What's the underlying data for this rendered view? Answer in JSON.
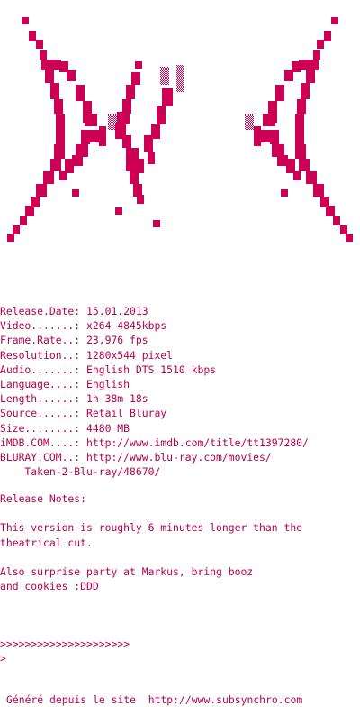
{
  "colors": {
    "text": "#b8004f",
    "art": "#cc0055",
    "background": "#ffffff"
  },
  "logo": {
    "icon": "butterfly-ascii-art-icon"
  },
  "info": [
    {
      "key": "Release.Date:",
      "value": "15.01.2013"
    },
    {
      "key": "Video.......:",
      "value": "x264 4845kbps"
    },
    {
      "key": "Frame.Rate..:",
      "value": "23,976 fps"
    },
    {
      "key": "Resolution..:",
      "value": "1280x544 pixel"
    },
    {
      "key": "Audio.......:",
      "value": "English DTS 1510 kbps"
    },
    {
      "key": "Language....:",
      "value": "English"
    },
    {
      "key": "Length......:",
      "value": "1h 38m 18s"
    },
    {
      "key": "Source......:",
      "value": "Retail Bluray"
    },
    {
      "key": "Size........:",
      "value": "4480 MB"
    },
    {
      "key": "iMDB.COM....:",
      "value": "http://www.imdb.com/title/tt1397280/"
    },
    {
      "key": "BLURAY.COM..:",
      "value": "http://www.blu-ray.com/movies/"
    }
  ],
  "bluray_cont": "    Taken-2-Blu-ray/48670/",
  "notes": {
    "heading": "Release Notes:",
    "p1_l1": "This version is roughly 6 minutes longer than the",
    "p1_l2": "theatrical cut.",
    "p2_l1": "Also surprise party at Markus, bring booz",
    "p2_l2": "and cookies :DDD"
  },
  "prompt": {
    "arrows": ">>>>>>>>>>>>>>>>>>>>>",
    "cursor": ">"
  },
  "footer": {
    "label": "Généré depuis le site",
    "url": "http://www.subsynchro.com"
  }
}
